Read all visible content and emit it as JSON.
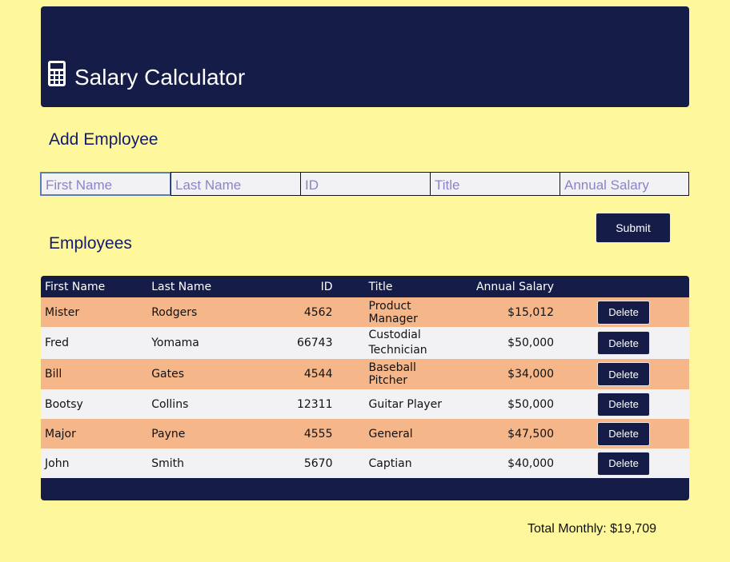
{
  "app": {
    "title": "Salary Calculator",
    "icon": "calculator-icon"
  },
  "add_section": {
    "title": "Add Employee",
    "fields": [
      {
        "placeholder": "First Name",
        "value": ""
      },
      {
        "placeholder": "Last Name",
        "value": ""
      },
      {
        "placeholder": "ID",
        "value": ""
      },
      {
        "placeholder": "Title",
        "value": ""
      },
      {
        "placeholder": "Annual Salary",
        "value": ""
      }
    ],
    "submit_label": "Submit"
  },
  "employees_section": {
    "title": "Employees",
    "columns": [
      "First Name",
      "Last Name",
      "ID",
      "Title",
      "Annual Salary"
    ],
    "rows": [
      {
        "first": "Mister",
        "last": "Rodgers",
        "id": "4562",
        "title": "Product Manager",
        "salary": "$15,012"
      },
      {
        "first": "Fred",
        "last": "Yomama",
        "id": "66743",
        "title": "Custodial Technician",
        "salary": "$50,000"
      },
      {
        "first": "Bill",
        "last": "Gates",
        "id": "4544",
        "title": "Baseball Pitcher",
        "salary": "$34,000"
      },
      {
        "first": "Bootsy",
        "last": "Collins",
        "id": "12311",
        "title": "Guitar Player",
        "salary": "$50,000"
      },
      {
        "first": "Major",
        "last": "Payne",
        "id": "4555",
        "title": "General",
        "salary": "$47,500"
      },
      {
        "first": "John",
        "last": "Smith",
        "id": "5670",
        "title": "Captian",
        "salary": "$40,000"
      }
    ],
    "delete_label": "Delete"
  },
  "total": {
    "text": "Total Monthly: $19,709"
  },
  "colors": {
    "background": "#fef79b",
    "navy": "#141c47",
    "row_highlight": "#f5b78a",
    "row_plain": "#f2f2f4"
  }
}
